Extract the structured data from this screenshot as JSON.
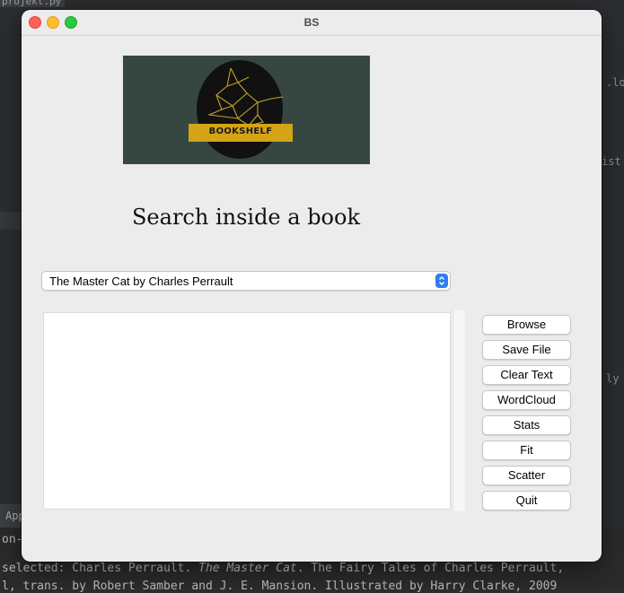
{
  "background": {
    "editor_tab": "projekt.py",
    "editor_fragments": [
      ".lo",
      "ist",
      "ly"
    ],
    "side_label": "App",
    "console_lines": [
      "on-",
      "selected: Charles Perrault. The Master Cat. The Fairy Tales of Charles Perrault,"
    ],
    "console_prefix_2": "selected: Charles Perrault. ",
    "console_italic_2": "The Master Cat",
    "console_suffix_2": ". The Fairy Tales of Charles Perrault,",
    "console_line_3": "l, trans. by Robert Samber and J. E. Mansion. Illustrated by Harry Clarke, 2009"
  },
  "window": {
    "title": "BS"
  },
  "logo": {
    "text": "BOOKSHELF",
    "colors": {
      "background": "#354740",
      "circle": "#111111",
      "banner": "#d4a416",
      "bird": "#c9a227"
    }
  },
  "heading": "Search inside a book",
  "book_select": {
    "selected": "The Master Cat by Charles Perrault"
  },
  "text_area": {
    "value": ""
  },
  "buttons": {
    "browse": "Browse",
    "save_file": "Save File",
    "clear_text": "Clear Text",
    "wordcloud": "WordCloud",
    "stats": "Stats",
    "fit": "Fit",
    "scatter": "Scatter",
    "quit": "Quit"
  },
  "colors": {
    "accent": "#2f7cf6",
    "window_bg": "#ececec"
  }
}
